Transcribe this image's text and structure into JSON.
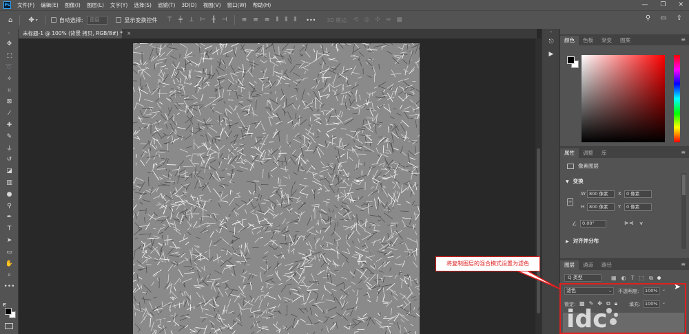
{
  "menubar": {
    "logo": "Ps",
    "items": [
      "文件(F)",
      "编辑(E)",
      "图像(I)",
      "图层(L)",
      "文字(Y)",
      "选择(S)",
      "滤镜(T)",
      "3D(D)",
      "视图(V)",
      "窗口(W)",
      "帮助(H)"
    ],
    "window_controls": [
      "—",
      "❐",
      "✕"
    ]
  },
  "optionsbar": {
    "auto_select_label": "自动选择:",
    "auto_select_value": "图层",
    "show_transform_label": "显示变换控件",
    "more_label": "•••",
    "mode_3d_label": "3D 模式:"
  },
  "document": {
    "tab_title": "未标题-1 @ 100% (背景 拷贝, RGB/8#) *",
    "tab_close": "×"
  },
  "color_panel": {
    "tabs": [
      "颜色",
      "色板",
      "渐变",
      "图案"
    ],
    "active_tab": 0,
    "fg_color": "#000000",
    "bg_color": "#ffffff"
  },
  "properties_panel": {
    "tabs": [
      "属性",
      "调整",
      "库"
    ],
    "active_tab": 0,
    "layer_type": "像素图层",
    "transform_title": "变换",
    "w_label": "W",
    "w_value": "800 像素",
    "h_label": "H",
    "h_value": "800 像素",
    "x_label": "X",
    "x_value": "0 像素",
    "y_label": "Y",
    "y_value": "0 像素",
    "angle_value": "0.00°",
    "align_title": "对齐并分布"
  },
  "layers_panel": {
    "tabs": [
      "图层",
      "通道",
      "路径"
    ],
    "active_tab": 0,
    "filter_label": "Q 类型",
    "blend_mode": "滤色",
    "opacity_label": "不透明度:",
    "opacity_value": "100%",
    "lock_label": "锁定:",
    "fill_label": "填充:",
    "fill_value": "100%"
  },
  "annotation": {
    "callout_text": "将复制图层的混合模式设置为滤色",
    "accent_color": "#e02020"
  },
  "watermark": {
    "text": "idc"
  }
}
